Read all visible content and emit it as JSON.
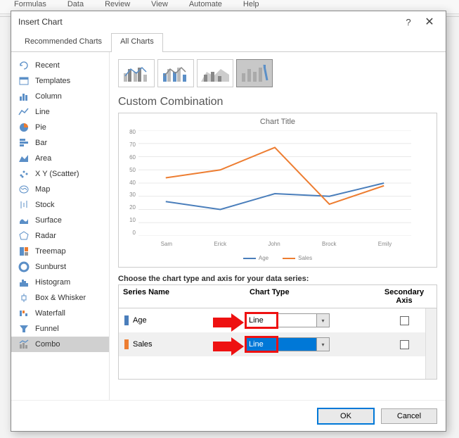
{
  "ribbon_tabs": [
    "Formulas",
    "Data",
    "Review",
    "View",
    "Automate",
    "Help"
  ],
  "dialog": {
    "title": "Insert Chart",
    "tabs": {
      "recommended": "Recommended Charts",
      "all": "All Charts"
    },
    "sidebar": [
      {
        "label": "Recent"
      },
      {
        "label": "Templates"
      },
      {
        "label": "Column"
      },
      {
        "label": "Line"
      },
      {
        "label": "Pie"
      },
      {
        "label": "Bar"
      },
      {
        "label": "Area"
      },
      {
        "label": "X Y (Scatter)"
      },
      {
        "label": "Map"
      },
      {
        "label": "Stock"
      },
      {
        "label": "Surface"
      },
      {
        "label": "Radar"
      },
      {
        "label": "Treemap"
      },
      {
        "label": "Sunburst"
      },
      {
        "label": "Histogram"
      },
      {
        "label": "Box & Whisker"
      },
      {
        "label": "Waterfall"
      },
      {
        "label": "Funnel"
      },
      {
        "label": "Combo"
      }
    ],
    "section_title": "Custom Combination",
    "preview_title": "Chart Title",
    "instruction": "Choose the chart type and axis for your data series:",
    "columns": {
      "name": "Series Name",
      "type": "Chart Type",
      "axis": "Secondary Axis"
    },
    "series": [
      {
        "name": "Age",
        "color": "#4a7ebb",
        "type": "Line",
        "selected": false
      },
      {
        "name": "Sales",
        "color": "#ed7d31",
        "type": "Line",
        "selected": true
      }
    ],
    "buttons": {
      "ok": "OK",
      "cancel": "Cancel"
    }
  },
  "chart_data": {
    "type": "line",
    "title": "Chart Title",
    "xlabel": "",
    "ylabel": "",
    "categories": [
      "Sam",
      "Erick",
      "John",
      "Brock",
      "Emily"
    ],
    "ylim": [
      0,
      80
    ],
    "y_ticks": [
      0,
      10,
      20,
      30,
      40,
      50,
      60,
      70,
      80
    ],
    "series": [
      {
        "name": "Age",
        "color": "#4a7ebb",
        "values": [
          26,
          20,
          32,
          30,
          40
        ]
      },
      {
        "name": "Sales",
        "color": "#ed7d31",
        "values": [
          44,
          50,
          67,
          24,
          38
        ]
      }
    ],
    "legend_position": "bottom"
  }
}
